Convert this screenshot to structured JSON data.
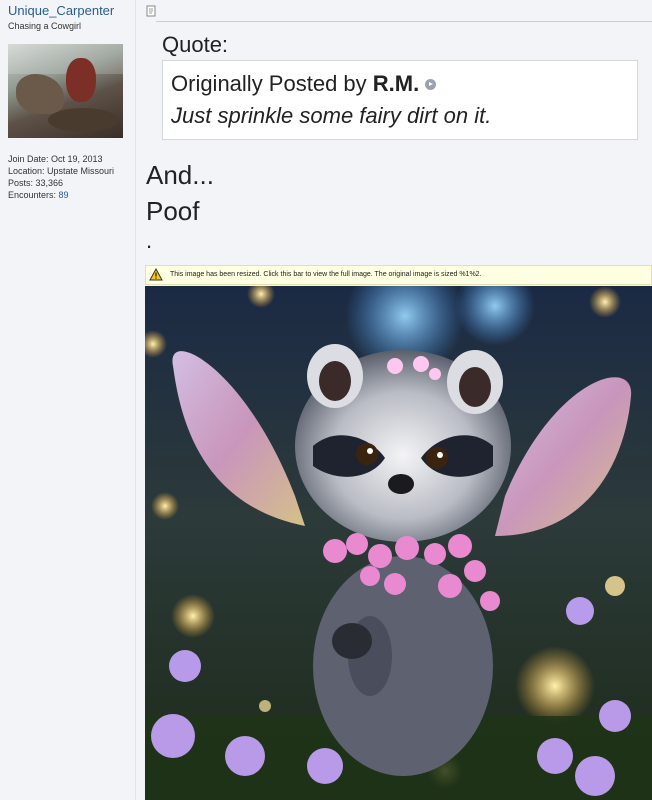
{
  "user": {
    "username": "Unique_Carpenter",
    "title": "Chasing a Cowgirl",
    "join_date": "Join Date: Oct 19, 2013",
    "location": "Location: Upstate Missouri",
    "posts": "Posts: 33,366",
    "encounters_label": "Encounters:",
    "encounters_value": "89"
  },
  "post": {
    "quote_label": "Quote:",
    "quote_prefix": "Originally Posted by",
    "quote_author": "R.M.",
    "quote_text": "Just sprinkle some fairy dirt on it.",
    "lines": [
      "And...",
      "Poof",
      "."
    ],
    "resize_notice": "This image has been resized. Click this bar to view the full image. The original image is sized %1%2."
  },
  "colors": {
    "link": "#2a5d8f",
    "notice_bg": "#ffffe1",
    "page_bg": "#f2f4f7"
  }
}
